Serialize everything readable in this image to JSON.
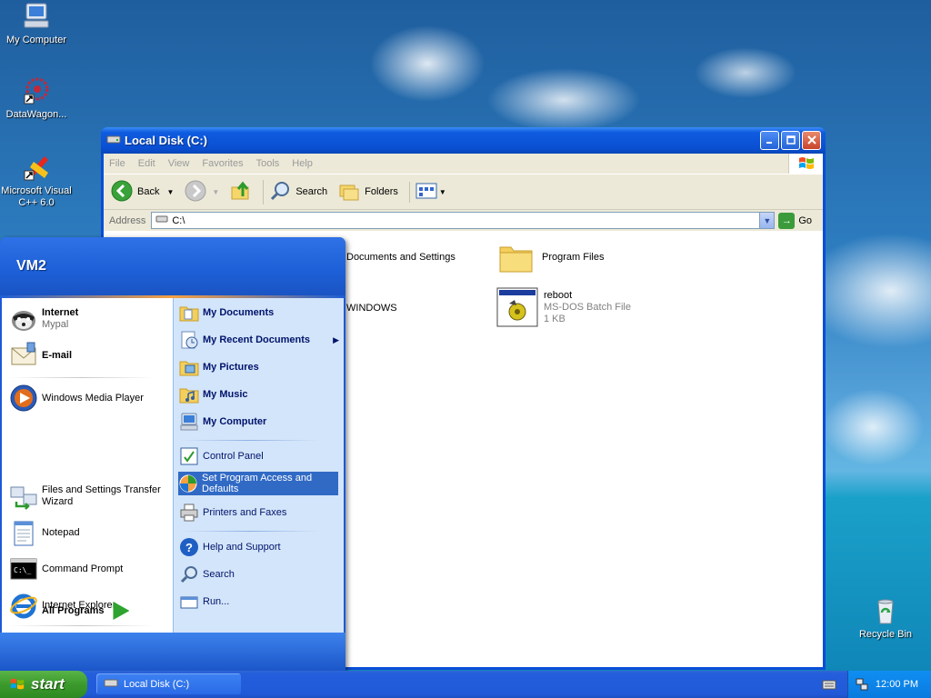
{
  "desktop": {
    "icons": [
      {
        "label": "My Computer",
        "icon": "my-computer-icon"
      },
      {
        "label": "DataWagon...",
        "icon": "datawagon-icon"
      },
      {
        "label": "Microsoft Visual C++ 6.0",
        "icon": "visual-cpp-icon"
      },
      {
        "label": "Recycle Bin",
        "icon": "recycle-bin-icon"
      }
    ]
  },
  "window": {
    "title": "Local Disk (C:)",
    "menu": [
      "File",
      "Edit",
      "View",
      "Favorites",
      "Tools",
      "Help"
    ],
    "toolbar": {
      "back": "Back",
      "search": "Search",
      "folders": "Folders"
    },
    "address": {
      "label": "Address",
      "value": "C:\\",
      "go": "Go"
    },
    "files": [
      {
        "name": "Documents and Settings",
        "type": "folder"
      },
      {
        "name": "Program Files",
        "type": "folder"
      },
      {
        "name": "WINDOWS",
        "type": "folder"
      },
      {
        "name": "reboot",
        "kind": "MS-DOS Batch File",
        "size": "1 KB",
        "type": "batch"
      }
    ]
  },
  "start_menu": {
    "user": "VM2",
    "pinned": [
      {
        "title": "Internet",
        "subtitle": "Mypal",
        "icon": "mypal-icon"
      },
      {
        "title": "E-mail",
        "subtitle": "",
        "icon": "email-icon"
      }
    ],
    "recent": [
      {
        "label": "Windows Media Player",
        "icon": "media-player-icon"
      },
      {
        "label": "Files and Settings Transfer Wizard",
        "icon": "transfer-wizard-icon"
      },
      {
        "label": "Notepad",
        "icon": "notepad-icon"
      },
      {
        "label": "Command Prompt",
        "icon": "command-prompt-icon"
      },
      {
        "label": "Internet Explorer",
        "icon": "internet-explorer-icon"
      }
    ],
    "all_programs": "All Programs",
    "right": [
      {
        "label": "My Documents",
        "icon": "my-documents-icon",
        "bold": true
      },
      {
        "label": "My Recent Documents",
        "icon": "recent-documents-icon",
        "bold": true
      },
      {
        "label": "My Pictures",
        "icon": "my-pictures-icon",
        "bold": true
      },
      {
        "label": "My Music",
        "icon": "my-music-icon",
        "bold": true
      },
      {
        "label": "My Computer",
        "icon": "my-computer-icon",
        "bold": true
      },
      {
        "label": "Control Panel",
        "icon": "control-panel-icon",
        "bold": false
      },
      {
        "label": "Set Program Access and Defaults",
        "icon": "program-access-icon",
        "bold": false,
        "highlighted": true
      },
      {
        "label": "Printers and Faxes",
        "icon": "printers-icon",
        "bold": false
      },
      {
        "label": "Help and Support",
        "icon": "help-icon",
        "bold": false
      },
      {
        "label": "Search",
        "icon": "search-icon",
        "bold": false
      },
      {
        "label": "Run...",
        "icon": "run-icon",
        "bold": false
      }
    ]
  },
  "taskbar": {
    "start_label": "start",
    "task": "Local Disk (C:)",
    "clock": "12:00 PM"
  }
}
